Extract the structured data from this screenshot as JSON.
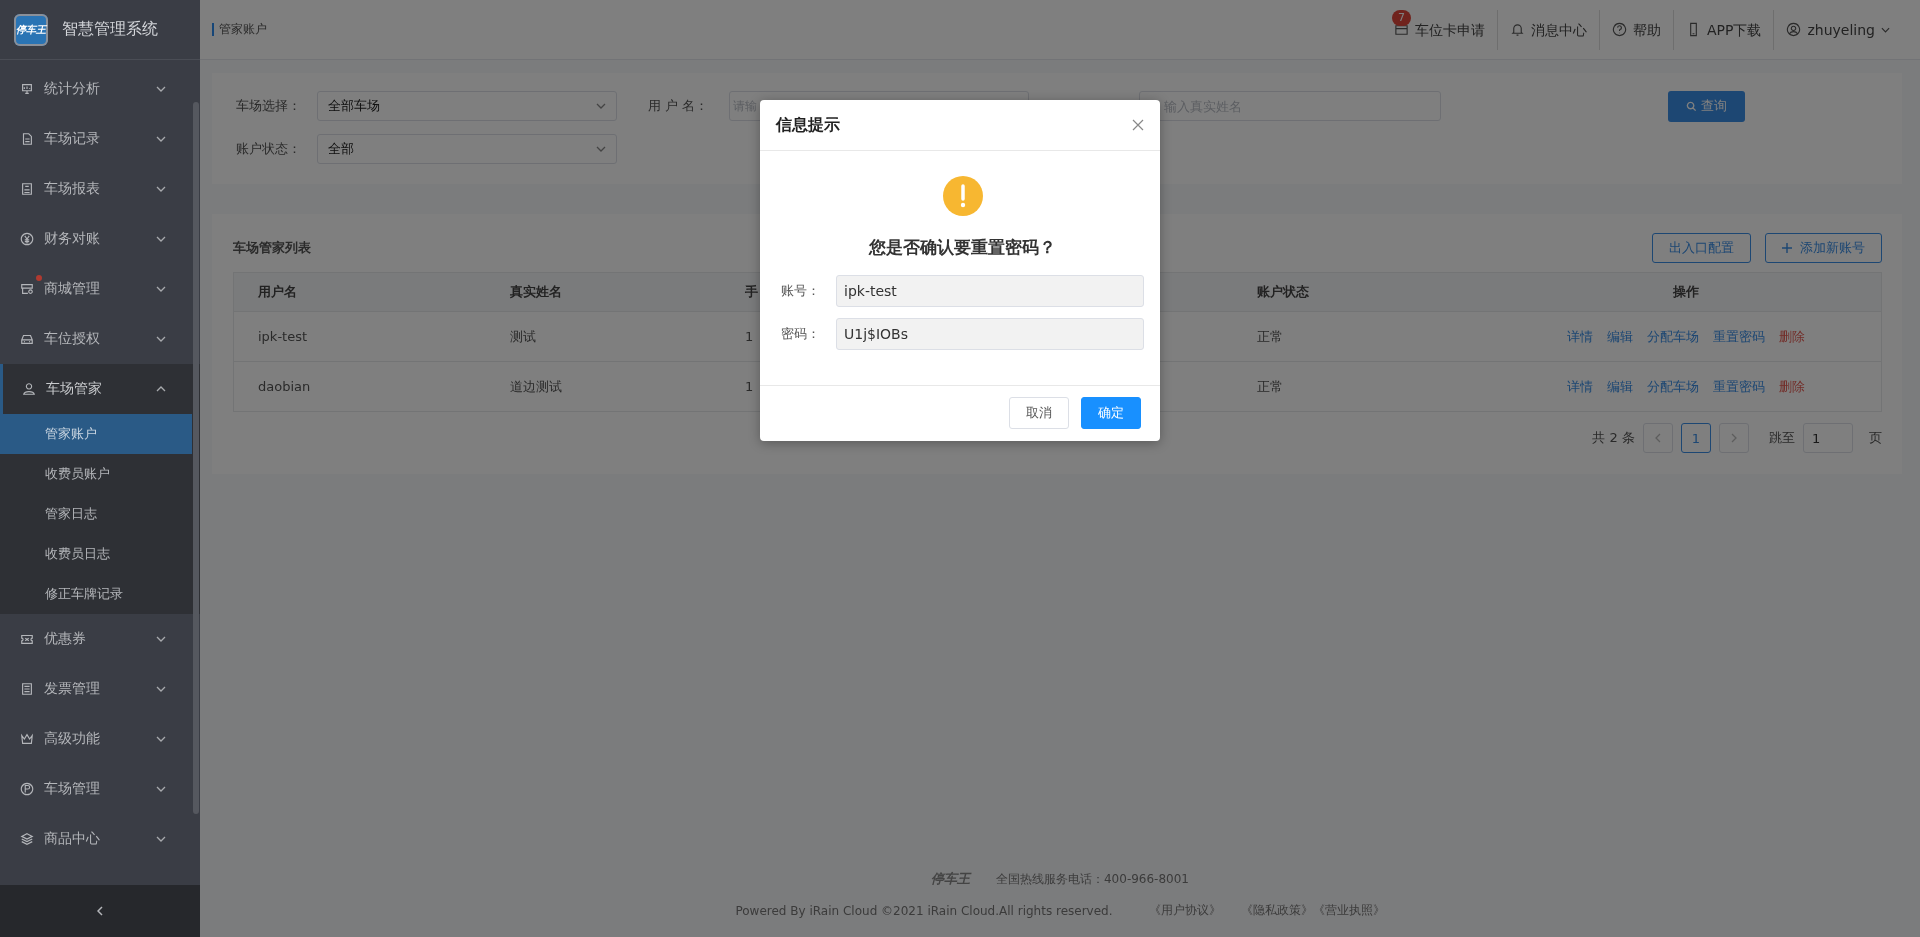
{
  "app": {
    "logo_text": "停车王",
    "title": "智慧管理系统"
  },
  "sidebar": {
    "items": [
      {
        "label": "统计分析",
        "expanded": false,
        "notification_dot": false
      },
      {
        "label": "车场记录",
        "expanded": false,
        "notification_dot": false
      },
      {
        "label": "车场报表",
        "expanded": false,
        "notification_dot": false
      },
      {
        "label": "财务对账",
        "expanded": false,
        "notification_dot": false
      },
      {
        "label": "商城管理",
        "expanded": false,
        "notification_dot": true
      },
      {
        "label": "车位授权",
        "expanded": false,
        "notification_dot": false
      },
      {
        "label": "车场管家",
        "expanded": true,
        "notification_dot": false,
        "children": [
          {
            "label": "管家账户",
            "selected": true
          },
          {
            "label": "收费员账户",
            "selected": false
          },
          {
            "label": "管家日志",
            "selected": false
          },
          {
            "label": "收费员日志",
            "selected": false
          },
          {
            "label": "修正车牌记录",
            "selected": false
          }
        ]
      },
      {
        "label": "优惠券",
        "expanded": false,
        "notification_dot": false
      },
      {
        "label": "发票管理",
        "expanded": false,
        "notification_dot": false
      },
      {
        "label": "高级功能",
        "expanded": false,
        "notification_dot": false
      },
      {
        "label": "车场管理",
        "expanded": false,
        "notification_dot": false
      },
      {
        "label": "商品中心",
        "expanded": false,
        "notification_dot": false
      }
    ]
  },
  "topbar": {
    "breadcrumb": "管家账户",
    "actions": [
      {
        "label": "车位卡申请",
        "badge": "7"
      },
      {
        "label": "消息中心"
      },
      {
        "label": "帮助"
      },
      {
        "label": "APP下载"
      }
    ],
    "user": "zhuyeling"
  },
  "filters": [
    {
      "kind": "select",
      "label": "车场选择：",
      "value": "全部车场"
    },
    {
      "kind": "input",
      "label": "用 户 名：",
      "placeholder": "请输"
    },
    {
      "kind": "input",
      "placeholder": "输入真实姓名"
    },
    {
      "kind": "select",
      "label": "账户状态：",
      "value": "全部"
    }
  ],
  "search_button": "查询",
  "table": {
    "title": "车场管家列表",
    "buttons": [
      {
        "label": "出入口配置",
        "kind": "plain"
      },
      {
        "label": "添加新账号",
        "kind": "add"
      }
    ],
    "columns": [
      "用户名",
      "真实姓名",
      "手",
      "账户状态",
      "操作"
    ],
    "rows": [
      {
        "cells": [
          "ipk-test",
          "测试",
          "1",
          "正常"
        ],
        "actions": [
          {
            "label": "详情",
            "kind": "link"
          },
          {
            "label": "编辑",
            "kind": "link"
          },
          {
            "label": "分配车场",
            "kind": "link"
          },
          {
            "label": "重置密码",
            "kind": "link"
          },
          {
            "label": "删除",
            "kind": "danger"
          }
        ]
      },
      {
        "cells": [
          "daobian",
          "道边测试",
          "1",
          "正常"
        ],
        "actions": [
          {
            "label": "详情",
            "kind": "link"
          },
          {
            "label": "编辑",
            "kind": "link"
          },
          {
            "label": "分配车场",
            "kind": "link"
          },
          {
            "label": "重置密码",
            "kind": "link"
          },
          {
            "label": "删除",
            "kind": "danger"
          }
        ]
      }
    ]
  },
  "pagination": {
    "total": "共 2 条",
    "pages": [
      {
        "label": "1",
        "selected": true
      }
    ],
    "jump_label": "跳至",
    "jump_value": "1",
    "unit": "页"
  },
  "dialog": {
    "title": "信息提示",
    "question": "您是否确认要重置密码？",
    "fields": [
      {
        "label": "账号：",
        "value": "ipk-test"
      },
      {
        "label": "密码：",
        "value": "U1j$IOBs"
      }
    ],
    "buttons": [
      {
        "label": "取消",
        "kind": "default"
      },
      {
        "label": "确定",
        "kind": "primary"
      }
    ]
  },
  "footer": {
    "logo_text": "停车王",
    "hotline": "全国热线服务电话：400-966-8001",
    "copyright": "Powered By iRain Cloud ©2021 iRain Cloud.All rights reserved.",
    "links": [
      "《用户协议》",
      "《隐私政策》",
      "《营业执照》"
    ]
  }
}
